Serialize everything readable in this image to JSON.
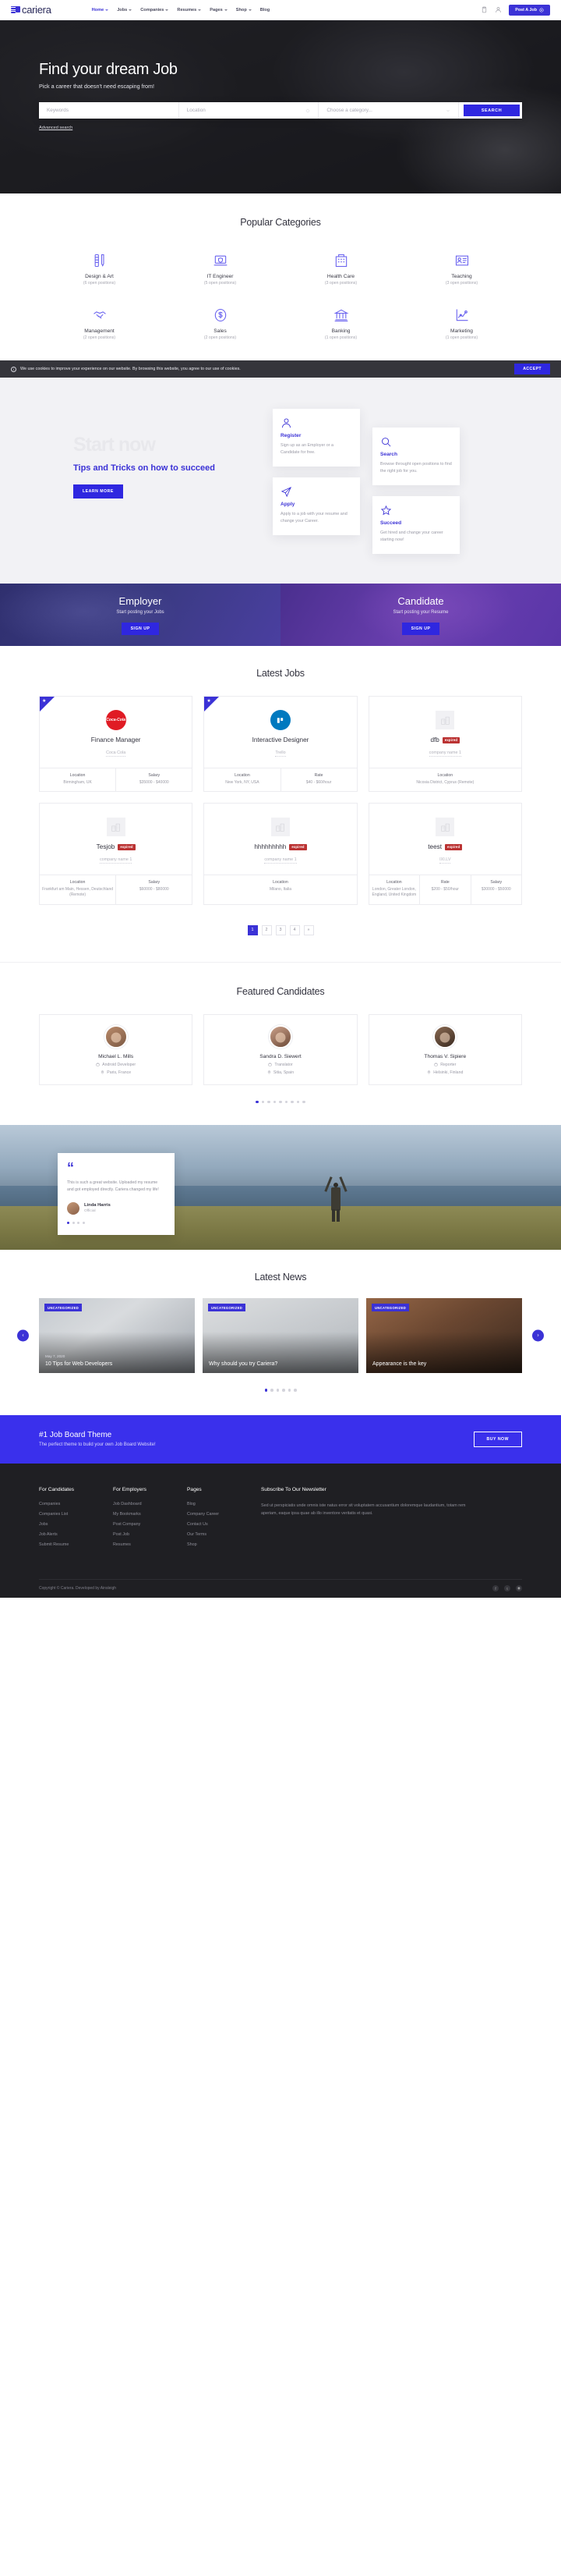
{
  "brand": {
    "name": "cariera",
    "logo_icon": "cariera-logo-icon"
  },
  "header": {
    "nav": [
      {
        "label": "Home",
        "active": true
      },
      {
        "label": "Jobs",
        "active": false
      },
      {
        "label": "Companies",
        "active": false
      },
      {
        "label": "Resumes",
        "active": false
      },
      {
        "label": "Pages",
        "active": false
      },
      {
        "label": "Shop",
        "active": false
      },
      {
        "label": "Blog",
        "active": false
      }
    ],
    "bookmarks_icon": "clipboard-icon",
    "account_icon": "user-icon",
    "post_job_label": "Post A Job",
    "post_job_icon": "plus-circle-icon"
  },
  "hero": {
    "title": "Find your dream Job",
    "subtitle": "Pick a career that doesn't need escaping from!",
    "keywords_placeholder": "Keywords",
    "location_placeholder": "Location",
    "location_icon": "crosshair-icon",
    "category_placeholder": "Choose a category...",
    "category_icon": "chevron-down-icon",
    "search_label": "SEARCH",
    "advanced_label": "Advanced search"
  },
  "categories": {
    "title": "Popular Categories",
    "items": [
      {
        "name": "Design & Art",
        "positions": "(6 open positions)",
        "icon": "ruler-pen-icon"
      },
      {
        "name": "IT Engineer",
        "positions": "(5 open positions)",
        "icon": "laptop-shield-icon"
      },
      {
        "name": "Health Care",
        "positions": "(3 open positions)",
        "icon": "hospital-icon"
      },
      {
        "name": "Teaching",
        "positions": "(3 open positions)",
        "icon": "teacher-board-icon"
      },
      {
        "name": "Management",
        "positions": "(2 open positions)",
        "icon": "handshake-icon"
      },
      {
        "name": "Sales",
        "positions": "(2 open positions)",
        "icon": "dollar-coin-icon"
      },
      {
        "name": "Banking",
        "positions": "(1 open positions)",
        "icon": "bank-icon"
      },
      {
        "name": "Marketing",
        "positions": "(1 open positions)",
        "icon": "line-chart-icon"
      }
    ]
  },
  "cookie": {
    "icon": "info-icon",
    "text": "We use cookies to improve your experience on our website. By browsing this website, you agree to our use of cookies.",
    "accept_label": "ACCEPT"
  },
  "startnow": {
    "ghost": "Start now",
    "heading": "Tips and Tricks on how to succeed",
    "button": "LEARN MORE",
    "cards": [
      {
        "icon": "user-icon",
        "title": "Register",
        "text": "Sign up as an Employer or a Candidate for free."
      },
      {
        "icon": "search-icon",
        "title": "Search",
        "text": "Browse throught open positions to find the right job for you."
      },
      {
        "icon": "paper-plane-icon",
        "title": "Apply",
        "text": "Apply to a job with your resume and change your Career."
      },
      {
        "icon": "star-icon",
        "title": "Succeed",
        "text": "Get hired and change your career starting now!"
      }
    ]
  },
  "banners": [
    {
      "title": "Employer",
      "subtitle": "Start posting your Jobs",
      "button": "SIGN UP"
    },
    {
      "title": "Candidate",
      "subtitle": "Start posting your Resume",
      "button": "SIGN UP"
    }
  ],
  "jobs": {
    "title": "Latest Jobs",
    "items": [
      {
        "featured": true,
        "title": "Finance Manager",
        "company": "Coca Cola",
        "logo_type": "coca-cola",
        "logo_text": "Coca-Cola",
        "logo_color": "#e01b24",
        "expired": null,
        "meta": [
          {
            "k": "Location",
            "v": "Birmingham, UK"
          },
          {
            "k": "Salary",
            "v": "$35000 - $40000"
          }
        ]
      },
      {
        "featured": true,
        "title": "Interactive Designer",
        "company": "Trello",
        "logo_type": "trello",
        "logo_text": "T",
        "logo_color": "#0079bf",
        "expired": null,
        "meta": [
          {
            "k": "Location",
            "v": "New York, NY, USA"
          },
          {
            "k": "Rate",
            "v": "$40 - $60/hour"
          }
        ]
      },
      {
        "featured": false,
        "title": "dfb",
        "company": "company name 1",
        "logo_type": "placeholder",
        "logo_text": "",
        "logo_color": "#f1f1f4",
        "expired": "expired",
        "meta": [
          {
            "k": "Location",
            "v": "Nicosia District, Cyprus (Remote)"
          }
        ]
      },
      {
        "featured": false,
        "title": "Tesjob",
        "company": "company name 1",
        "logo_type": "placeholder",
        "logo_text": "",
        "logo_color": "#f1f1f4",
        "expired": "expired",
        "meta": [
          {
            "k": "Location",
            "v": "Frankfurt am Main, Hessen, Deutschland (Remote)"
          },
          {
            "k": "Salary",
            "v": "$60000 - $80000"
          }
        ]
      },
      {
        "featured": false,
        "title": "hhhhhhhhh",
        "company": "company name 1",
        "logo_type": "placeholder",
        "logo_text": "",
        "logo_color": "#f1f1f4",
        "expired": "expired",
        "meta": [
          {
            "k": "Location",
            "v": "Milano, Italia"
          }
        ]
      },
      {
        "featured": false,
        "title": "teest",
        "company": "IXI.LV",
        "logo_type": "placeholder",
        "logo_text": "",
        "logo_color": "#f1f1f4",
        "expired": "expired",
        "meta": [
          {
            "k": "Location",
            "v": "London, Greater London, England, United Kingdom"
          },
          {
            "k": "Rate",
            "v": "$200 - $50/hour"
          },
          {
            "k": "Salary",
            "v": "$30000 - $50000"
          }
        ]
      }
    ],
    "pagination": [
      {
        "label": "1",
        "active": true
      },
      {
        "label": "2",
        "active": false
      },
      {
        "label": "3",
        "active": false
      },
      {
        "label": "4",
        "active": false
      },
      {
        "label": "»",
        "active": false
      }
    ]
  },
  "candidates": {
    "title": "Featured Candidates",
    "items": [
      {
        "name": "Michael L. Mills",
        "role": "Android Developer",
        "location": "Paris, France",
        "role_icon": "briefcase-icon",
        "loc_icon": "pin-icon"
      },
      {
        "name": "Sandra D. Siewert",
        "role": "Translator",
        "location": "Sitia, Spain",
        "role_icon": "briefcase-icon",
        "loc_icon": "pin-icon"
      },
      {
        "name": "Thomas V. Sipiere",
        "role": "Reporter",
        "location": "Helsinki, Finland",
        "role_icon": "briefcase-icon",
        "loc_icon": "pin-icon"
      }
    ],
    "dots": 9,
    "active_dot": 0
  },
  "testimonial": {
    "quote_icon": "quote-icon",
    "text": "This is such a great website. Uploaded my resume and got employed directly. Cariera changed my life!",
    "author": "Linda Harris",
    "role": "Official",
    "dots": 4,
    "active_dot": 0
  },
  "news": {
    "title": "Latest News",
    "prev_icon": "chevron-left-icon",
    "next_icon": "chevron-right-icon",
    "items": [
      {
        "tag": "UNCATEGORIZED",
        "date": "May 7, 2020",
        "title": "10 Tips for Web Developers"
      },
      {
        "tag": "UNCATEGORIZED",
        "date": "",
        "title": "Why should you try Cariera?"
      },
      {
        "tag": "UNCATEGORIZED",
        "date": "",
        "title": "Appearance is the key"
      }
    ],
    "dots": 6,
    "active_dot": 0
  },
  "cta": {
    "title": "#1 Job Board Theme",
    "subtitle": "The perfect theme to build your own Job Board Website!",
    "button": "BUY NOW"
  },
  "footer": {
    "columns": [
      {
        "title": "For Candidates",
        "links": [
          "Companies",
          "Companies List",
          "Jobs",
          "Job Alerts",
          "Submit Resume"
        ]
      },
      {
        "title": "For Employers",
        "links": [
          "Job Dashboard",
          "My Bookmarks",
          "Post Company",
          "Post Job",
          "Resumes"
        ]
      },
      {
        "title": "Pages",
        "links": [
          "Blog",
          "Company Career",
          "Contact Us",
          "Our Terms",
          "Shop"
        ]
      }
    ],
    "newsletter": {
      "title": "Subscribe To Our Newsletter",
      "text": "Sed ut perspiciatis unde omnis iste natus error sit voluptatem accusantium doloremque laudantium, totam rem aperiam, eaque ipsa quae ab illo inventore veritatis et quasi."
    },
    "copyright": "Copyright © Cariera. Developed by Ainsleigh",
    "socials": [
      {
        "name": "facebook-icon",
        "glyph": "f"
      },
      {
        "name": "twitter-icon",
        "glyph": "t"
      },
      {
        "name": "instagram-icon",
        "glyph": "◉"
      }
    ]
  }
}
